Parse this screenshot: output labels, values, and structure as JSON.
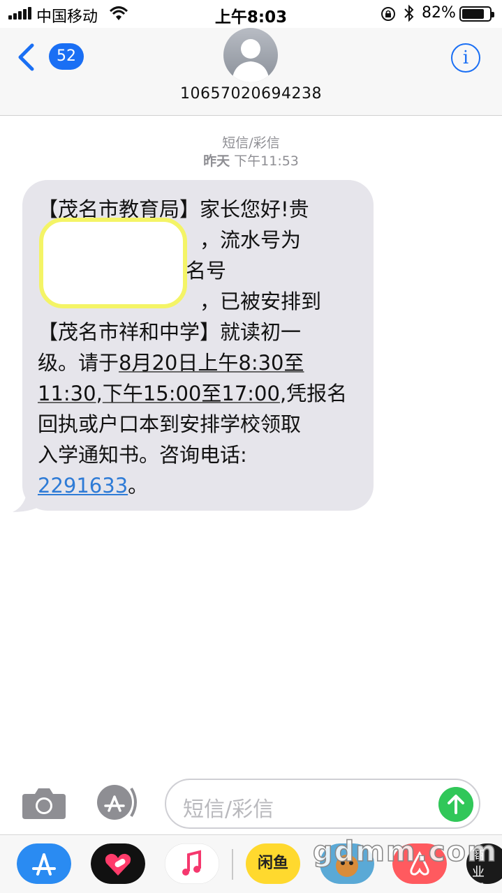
{
  "status_bar": {
    "carrier": "中国移动",
    "time": "上午8:03",
    "battery_percent": "82%",
    "battery_level": 0.82
  },
  "header": {
    "unread_count": "52",
    "contact_number": "10657020694238",
    "info_label": "i"
  },
  "conversation": {
    "message_type": "短信/彩信",
    "date": "昨天",
    "time": "下午11:53",
    "message": {
      "line1": "【茂名市教育局】家长您好!贵",
      "line2_tail": "，流水号为",
      "line3_tail": "名号",
      "line4_tail": "，已被安排到",
      "line5": "【茂名市祥和中学】就读初一",
      "line6_a": "级。请于",
      "line6_b": "8月20日上午8:30至",
      "line7_a": "11:30",
      "line7_b": ",",
      "line7_c": "下午15:00至17:00",
      "line7_d": ",凭报名",
      "line8": "回执或户口本到安排学校领取",
      "line9": "入学通知书。咨询电话:",
      "phone": "2291633",
      "line10_end": "。"
    }
  },
  "input_bar": {
    "placeholder": "短信/彩信"
  },
  "dock": {
    "apps": [
      "app-store-icon",
      "digital-touch-icon",
      "music-icon",
      "xianyu-icon",
      "game-icon",
      "airbnb-icon",
      "bloomberg-icon"
    ],
    "xianyu_label": "闲鱼",
    "bloomberg_label": "商业周刊"
  },
  "watermark": "gdmm.com",
  "colors": {
    "accent": "#1a6ff4",
    "bubble": "#e6e5eb",
    "send": "#31c759",
    "link": "#2e7bd6"
  }
}
